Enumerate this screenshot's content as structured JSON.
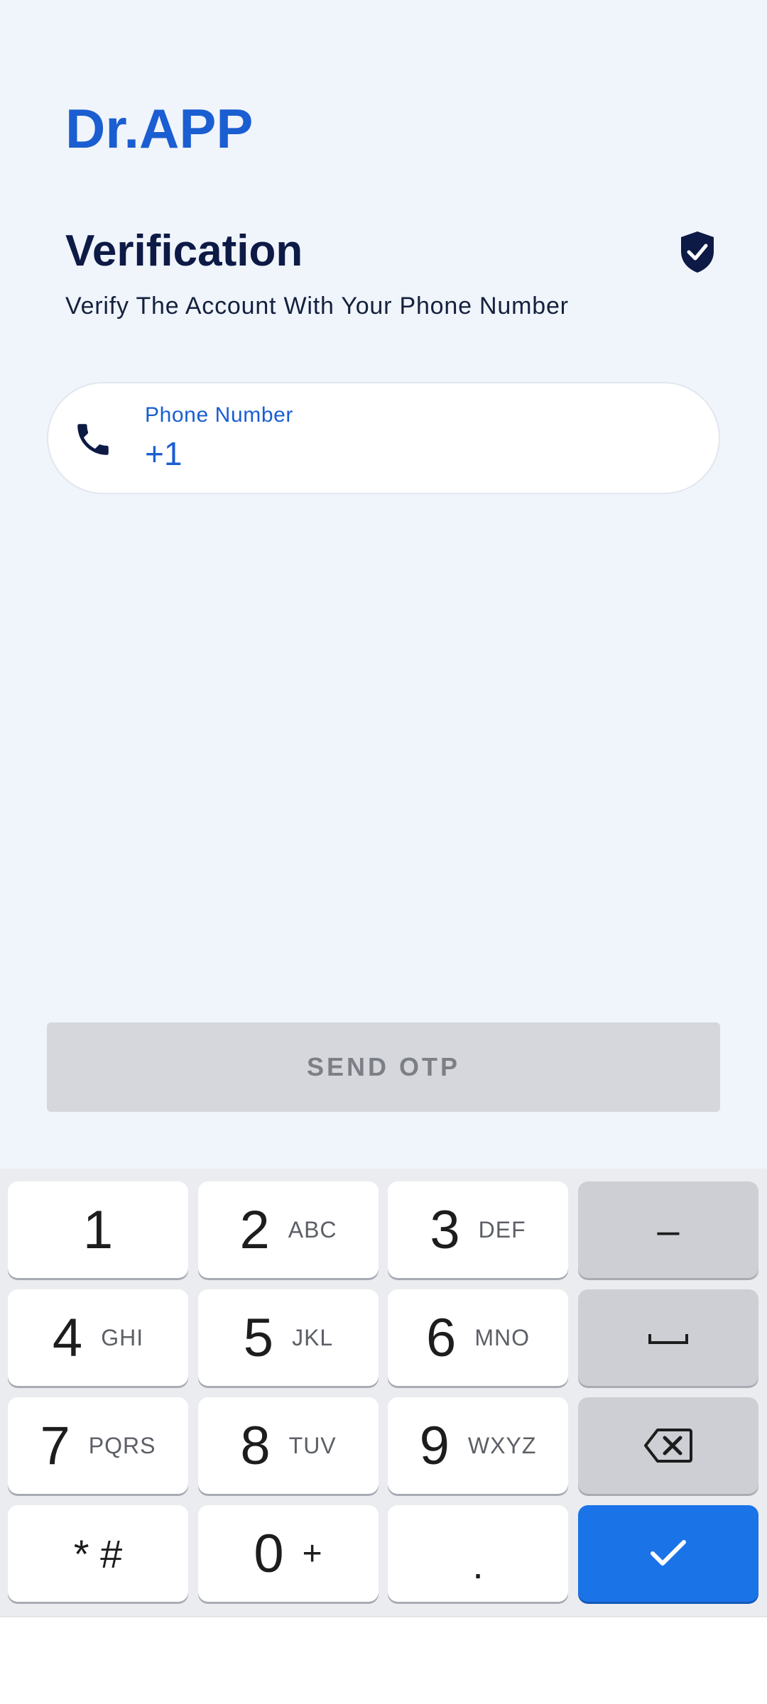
{
  "header": {
    "brand": "Dr.APP",
    "title": "Verification",
    "subtitle": "Verify The Account With Your Phone Number"
  },
  "phone_field": {
    "label": "Phone Number",
    "value": "+1",
    "icon": "phone-icon"
  },
  "send_button": {
    "label": "SEND OTP"
  },
  "keyboard": {
    "keys": [
      {
        "main": "1",
        "sub": ""
      },
      {
        "main": "2",
        "sub": "ABC"
      },
      {
        "main": "3",
        "sub": "DEF"
      },
      {
        "main": "4",
        "sub": "GHI"
      },
      {
        "main": "5",
        "sub": "JKL"
      },
      {
        "main": "6",
        "sub": "MNO"
      },
      {
        "main": "7",
        "sub": "PQRS"
      },
      {
        "main": "8",
        "sub": "TUV"
      },
      {
        "main": "9",
        "sub": "WXYZ"
      },
      {
        "main": "* #",
        "sub": ""
      },
      {
        "main": "0",
        "sub": "+"
      },
      {
        "main": ".",
        "sub": ""
      }
    ],
    "side_keys": {
      "dash": "–",
      "space_icon": "space-icon",
      "backspace_icon": "backspace-icon",
      "done_icon": "check-icon"
    }
  },
  "colors": {
    "brand": "#1a5ed1",
    "title": "#0d1a45",
    "background": "#f0f4fb",
    "button_disabled": "#d5d7dd",
    "keyboard_accent": "#1b73e8"
  }
}
